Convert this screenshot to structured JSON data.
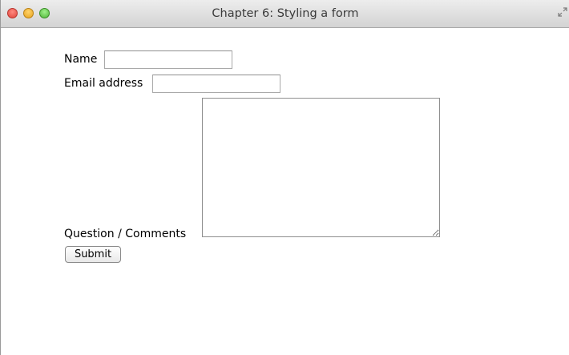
{
  "window": {
    "title": "Chapter 6: Styling a form"
  },
  "form": {
    "name_label": "Name",
    "name_value": "",
    "email_label": "Email address",
    "email_value": "",
    "comments_label": "Question / Comments",
    "comments_value": "",
    "submit_label": "Submit"
  }
}
